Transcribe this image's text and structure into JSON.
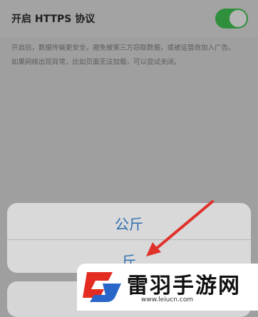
{
  "setting": {
    "title": "开启 HTTPS 协议",
    "toggle_on": true,
    "description_lines": [
      "开启后，数据传输更安全，避免被第三方窃取数据，或被运营商加入广告。",
      "如果网络出现异常，比如页面无法加载，可以尝试关闭。"
    ]
  },
  "action_sheet": {
    "options": [
      "公斤",
      "斤"
    ]
  },
  "watermark": {
    "title": "雷羽手游网",
    "url": "www.leiucn.com"
  },
  "colors": {
    "toggle_on": "#2f8f3c",
    "option_text": "#2f6db0",
    "arrow": "#e0312b",
    "logo_red": "#e32b22",
    "logo_blue": "#2a66c9"
  }
}
